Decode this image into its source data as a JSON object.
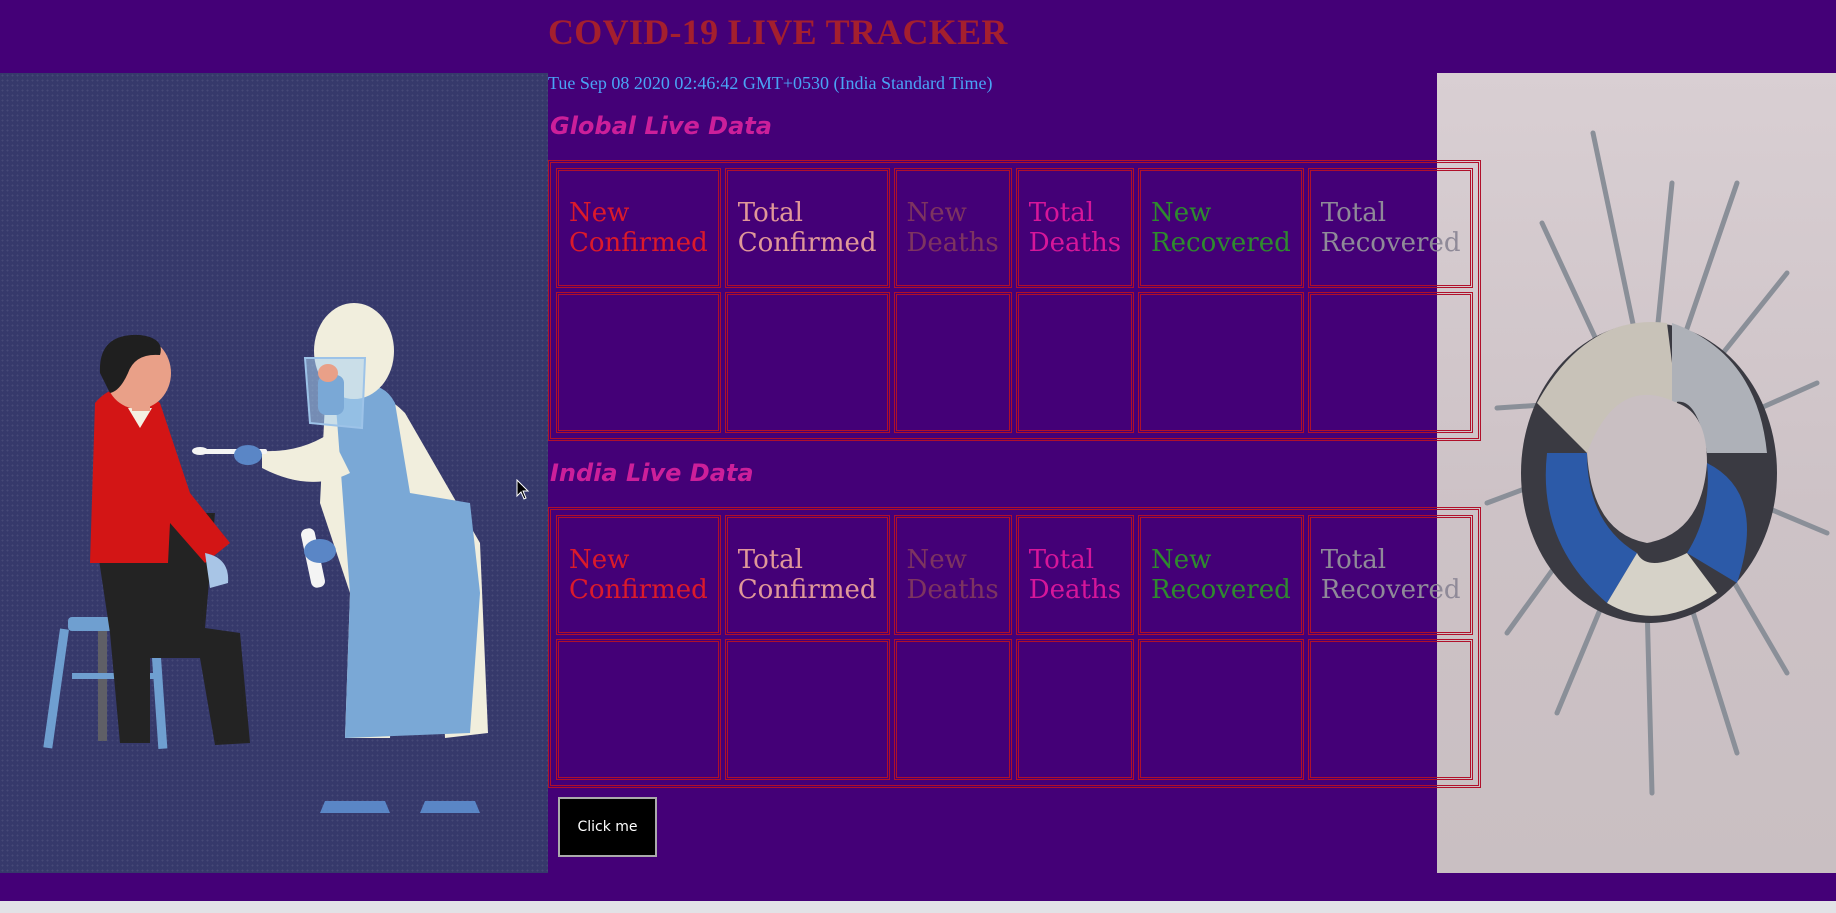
{
  "header": {
    "title": "COVID-19 LIVE TRACKER",
    "datetime": "Tue Sep 08 2020 02:46:42 GMT+0530 (India Standard Time)"
  },
  "global": {
    "heading": "Global Live Data",
    "columns": [
      "New Confirmed",
      "Total Confirmed",
      "New Deaths",
      "Total Deaths",
      "New Recovered",
      "Total Recovered"
    ],
    "values": [
      "",
      "",
      "",
      "",
      "",
      ""
    ]
  },
  "india": {
    "heading": "India Live Data",
    "columns": [
      "New Confirmed",
      "Total Confirmed",
      "New Deaths",
      "Total Deaths",
      "New Recovered",
      "Total Recovered"
    ],
    "values": [
      "",
      "",
      "",
      "",
      "",
      ""
    ]
  },
  "button": {
    "label": "Click me"
  },
  "images": {
    "left": "covid-swab-test-illustration",
    "right": "virus-sculpture-photo"
  },
  "colors": {
    "background": "#440077",
    "title": "#a41f2e",
    "datetime": "#4aa3f5",
    "heading": "#cc1f9a",
    "border": "#b0102a",
    "new_confirmed": "#dc1a2a",
    "total_confirmed": "#e09898",
    "new_deaths": "#7d3460",
    "total_deaths": "#d6169a",
    "new_recovered": "#2e8b2e",
    "total_recovered": "#8f8a98"
  }
}
